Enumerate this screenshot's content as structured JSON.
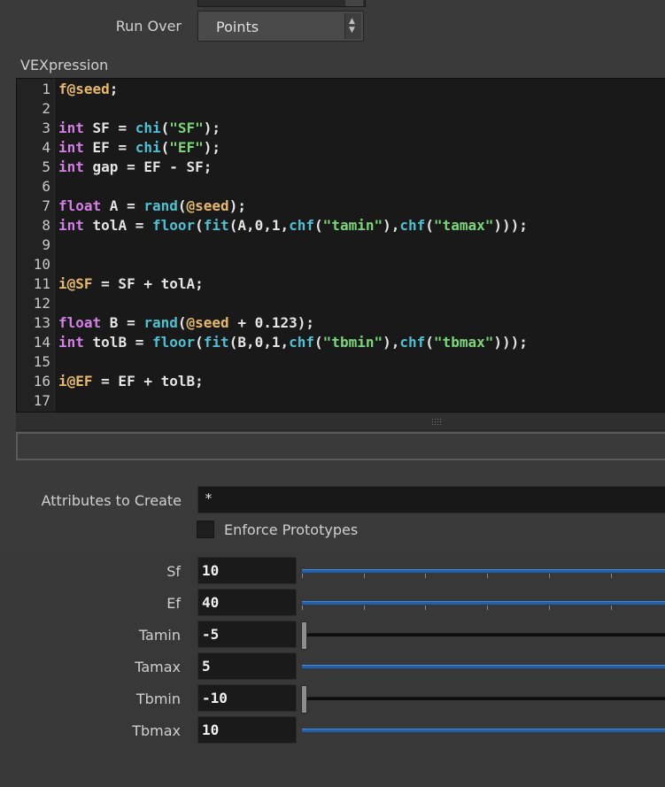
{
  "run_over": {
    "label": "Run Over",
    "value": "Points",
    "spin_up": "▲",
    "spin_down": "▼"
  },
  "vexpression": {
    "label": "VEXpression",
    "lines": [
      {
        "n": "1",
        "tokens": [
          [
            "at",
            "f@seed"
          ],
          [
            "pl",
            ";"
          ]
        ]
      },
      {
        "n": "2",
        "tokens": []
      },
      {
        "n": "3",
        "tokens": [
          [
            "kw",
            "int"
          ],
          [
            "pl",
            " SF = "
          ],
          [
            "fn",
            "chi"
          ],
          [
            "pl",
            "("
          ],
          [
            "st",
            "\"SF\""
          ],
          [
            "pl",
            ");"
          ]
        ]
      },
      {
        "n": "4",
        "tokens": [
          [
            "kw",
            "int"
          ],
          [
            "pl",
            " EF = "
          ],
          [
            "fn",
            "chi"
          ],
          [
            "pl",
            "("
          ],
          [
            "st",
            "\"EF\""
          ],
          [
            "pl",
            ");"
          ]
        ]
      },
      {
        "n": "5",
        "tokens": [
          [
            "kw",
            "int"
          ],
          [
            "pl",
            " gap = EF - SF;"
          ]
        ]
      },
      {
        "n": "6",
        "tokens": []
      },
      {
        "n": "7",
        "tokens": [
          [
            "kw",
            "float"
          ],
          [
            "pl",
            " A = "
          ],
          [
            "fn",
            "rand"
          ],
          [
            "pl",
            "("
          ],
          [
            "at",
            "@seed"
          ],
          [
            "pl",
            ");"
          ]
        ]
      },
      {
        "n": "8",
        "tokens": [
          [
            "kw",
            "int"
          ],
          [
            "pl",
            " tolA = "
          ],
          [
            "fn",
            "floor"
          ],
          [
            "pl",
            "("
          ],
          [
            "fn",
            "fit"
          ],
          [
            "pl",
            "(A,0,1,"
          ],
          [
            "fn",
            "chf"
          ],
          [
            "pl",
            "("
          ],
          [
            "st",
            "\"tamin\""
          ],
          [
            "pl",
            "),"
          ],
          [
            "fn",
            "chf"
          ],
          [
            "pl",
            "("
          ],
          [
            "st",
            "\"tamax\""
          ],
          [
            "pl",
            ")));"
          ]
        ]
      },
      {
        "n": "9",
        "tokens": []
      },
      {
        "n": "10",
        "tokens": []
      },
      {
        "n": "11",
        "tokens": [
          [
            "at",
            "i@SF"
          ],
          [
            "pl",
            " = SF + tolA;"
          ]
        ]
      },
      {
        "n": "12",
        "tokens": []
      },
      {
        "n": "13",
        "tokens": [
          [
            "kw",
            "float"
          ],
          [
            "pl",
            " B = "
          ],
          [
            "fn",
            "rand"
          ],
          [
            "pl",
            "("
          ],
          [
            "at",
            "@seed"
          ],
          [
            "pl",
            " + 0.123);"
          ]
        ]
      },
      {
        "n": "14",
        "tokens": [
          [
            "kw",
            "int"
          ],
          [
            "pl",
            " tolB = "
          ],
          [
            "fn",
            "floor"
          ],
          [
            "pl",
            "("
          ],
          [
            "fn",
            "fit"
          ],
          [
            "pl",
            "(B,0,1,"
          ],
          [
            "fn",
            "chf"
          ],
          [
            "pl",
            "("
          ],
          [
            "st",
            "\"tbmin\""
          ],
          [
            "pl",
            "),"
          ],
          [
            "fn",
            "chf"
          ],
          [
            "pl",
            "("
          ],
          [
            "st",
            "\"tbmax\""
          ],
          [
            "pl",
            ")));"
          ]
        ]
      },
      {
        "n": "15",
        "tokens": []
      },
      {
        "n": "16",
        "tokens": [
          [
            "at",
            "i@EF"
          ],
          [
            "pl",
            " = EF + tolB;"
          ]
        ]
      },
      {
        "n": "17",
        "tokens": []
      }
    ]
  },
  "attributes_to_create": {
    "label": "Attributes to Create",
    "value": "*"
  },
  "enforce_prototypes": {
    "label": "Enforce Prototypes",
    "checked": false
  },
  "params": [
    {
      "id": "sf",
      "label": "Sf",
      "value": "10",
      "slider_level": 1.0
    },
    {
      "id": "ef",
      "label": "Ef",
      "value": "40",
      "slider_level": 1.0
    },
    {
      "id": "tamin",
      "label": "Tamin",
      "value": "-5",
      "slider_level": 0.0
    },
    {
      "id": "tamax",
      "label": "Tamax",
      "value": "5",
      "slider_level": 1.0
    },
    {
      "id": "tbmin",
      "label": "Tbmin",
      "value": "-10",
      "slider_level": 0.0
    },
    {
      "id": "tbmax",
      "label": "Tbmax",
      "value": "10",
      "slider_level": 1.0
    }
  ],
  "colors": {
    "keyword": "#d47fe8",
    "function": "#4ec0d2",
    "string": "#7bd67b",
    "attribute": "#e6b86d",
    "slider": "#1f5fb0"
  }
}
